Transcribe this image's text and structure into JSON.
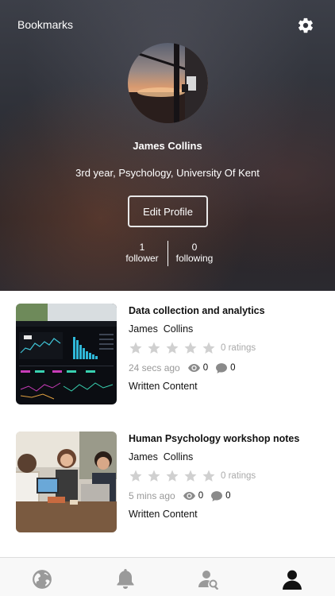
{
  "header": {
    "bookmarks_label": "Bookmarks",
    "name": "James Collins",
    "description": "3rd year, Psychology, University Of Kent",
    "edit_profile_label": "Edit Profile",
    "followers": {
      "count": "1",
      "label": "follower"
    },
    "following": {
      "count": "0",
      "label": "following"
    }
  },
  "cards": [
    {
      "title": "Data collection and analytics",
      "author": "James  Collins",
      "ratings_label": "0 ratings",
      "time": "24 secs ago",
      "views": "0",
      "comments": "0",
      "type": "Written Content"
    },
    {
      "title": "Human Psychology workshop notes",
      "author": "James  Collins",
      "ratings_label": "0 ratings",
      "time": "5 mins ago",
      "views": "0",
      "comments": "0",
      "type": "Written Content"
    }
  ],
  "colors": {
    "star": "#d0d0d0",
    "tab_inactive": "#9a9a9a",
    "tab_active": "#111111"
  },
  "tabs": [
    {
      "icon": "globe-icon",
      "active": false
    },
    {
      "icon": "bell-icon",
      "active": false
    },
    {
      "icon": "user-search-icon",
      "active": false
    },
    {
      "icon": "profile-icon",
      "active": true
    }
  ]
}
